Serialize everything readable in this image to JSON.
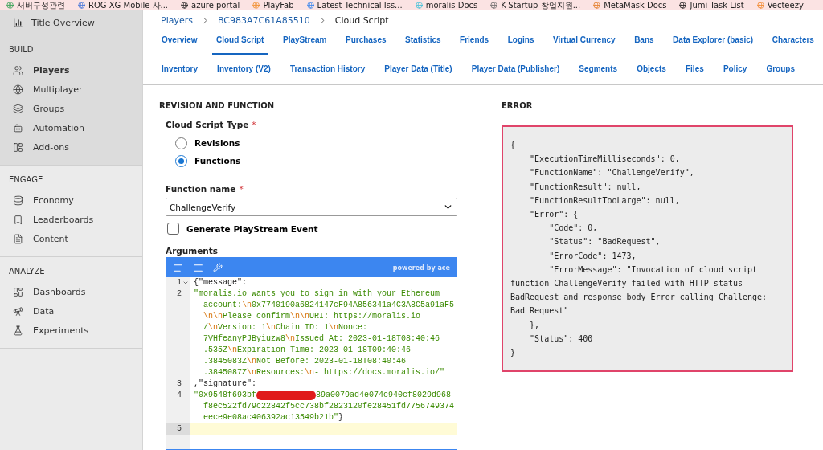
{
  "bookmarks": [
    "서버구성관련",
    "ROG XG Mobile 사...",
    "azure portal",
    "PlayFab",
    "Latest Technical Iss...",
    "moralis Docs",
    "K-Startup 창업지원...",
    "MetaMask Docs",
    "Jumi Task List",
    "Vecteezy"
  ],
  "sidebar": {
    "top": {
      "label": "Title Overview"
    },
    "sections": [
      {
        "title": "BUILD",
        "items": [
          {
            "label": "Players",
            "selected": true
          },
          {
            "label": "Multiplayer",
            "selected": false
          },
          {
            "label": "Groups",
            "selected": false
          },
          {
            "label": "Automation",
            "selected": false
          },
          {
            "label": "Add-ons",
            "selected": false
          }
        ]
      },
      {
        "title": "ENGAGE",
        "items": [
          {
            "label": "Economy",
            "selected": false
          },
          {
            "label": "Leaderboards",
            "selected": false
          },
          {
            "label": "Content",
            "selected": false
          }
        ]
      },
      {
        "title": "ANALYZE",
        "items": [
          {
            "label": "Dashboards",
            "selected": false
          },
          {
            "label": "Data",
            "selected": false
          },
          {
            "label": "Experiments",
            "selected": false
          }
        ]
      }
    ]
  },
  "breadcrumb": [
    "Players",
    "BC983A7C61A85510",
    "Cloud Script"
  ],
  "tab_rows": [
    [
      {
        "label": "Overview",
        "selected": false
      },
      {
        "label": "Cloud Script",
        "selected": true
      },
      {
        "label": "PlayStream",
        "selected": false
      },
      {
        "label": "Purchases",
        "selected": false
      },
      {
        "label": "Statistics",
        "selected": false
      },
      {
        "label": "Friends",
        "selected": false
      },
      {
        "label": "Logins",
        "selected": false
      },
      {
        "label": "Virtual Currency",
        "selected": false
      },
      {
        "label": "Bans",
        "selected": false
      },
      {
        "label": "Data Explorer (basic)",
        "selected": false
      },
      {
        "label": "Characters",
        "selected": false
      }
    ],
    [
      {
        "label": "Inventory",
        "selected": false
      },
      {
        "label": "Inventory (V2)",
        "selected": false
      },
      {
        "label": "Transaction History",
        "selected": false
      },
      {
        "label": "Player Data (Title)",
        "selected": false
      },
      {
        "label": "Player Data (Publisher)",
        "selected": false
      },
      {
        "label": "Segments",
        "selected": false
      },
      {
        "label": "Objects",
        "selected": false
      },
      {
        "label": "Files",
        "selected": false
      },
      {
        "label": "Policy",
        "selected": false
      },
      {
        "label": "Groups",
        "selected": false
      }
    ]
  ],
  "revision": {
    "heading": "REVISION AND FUNCTION",
    "type_label": "Cloud Script Type",
    "type_mark": "*",
    "types": [
      {
        "label": "Revisions",
        "selected": false
      },
      {
        "label": "Functions",
        "selected": true
      }
    ],
    "function_label": "Function name",
    "function_mark": "*",
    "function_value": "ChallengeVerify",
    "playstream": {
      "label": "Generate PlayStream Event",
      "checked": false
    },
    "arguments_label": "Arguments",
    "editor_brand": "powered by ace",
    "lines": [
      {
        "number": "1",
        "fold": true,
        "active": false,
        "rows": [
          {
            "segments": [
              {
                "kind": "text",
                "text": "{\"message\":"
              }
            ]
          }
        ]
      },
      {
        "number": "2",
        "fold": false,
        "active": false,
        "rows": [
          {
            "segments": [
              {
                "kind": "string",
                "text": "\"moralis.io wants you to sign in with your Ethereum"
              }
            ]
          },
          {
            "segments": [
              {
                "kind": "string",
                "text": "account:"
              },
              {
                "kind": "escape",
                "text": "\\n"
              },
              {
                "kind": "string",
                "text": "0x7740190a6824147cF94A856341a4C3A8C5a91aF5"
              }
            ]
          },
          {
            "segments": [
              {
                "kind": "escape",
                "text": "\\n\\n"
              },
              {
                "kind": "string",
                "text": "Please confirm"
              },
              {
                "kind": "escape",
                "text": "\\n\\n"
              },
              {
                "kind": "string",
                "text": "URI: https://moralis.io"
              }
            ]
          },
          {
            "segments": [
              {
                "kind": "string",
                "text": "/"
              },
              {
                "kind": "escape",
                "text": "\\n"
              },
              {
                "kind": "string",
                "text": "Version: 1"
              },
              {
                "kind": "escape",
                "text": "\\n"
              },
              {
                "kind": "string",
                "text": "Chain ID: 1"
              },
              {
                "kind": "escape",
                "text": "\\n"
              },
              {
                "kind": "string",
                "text": "Nonce:"
              }
            ]
          },
          {
            "segments": [
              {
                "kind": "string",
                "text": "7VHfeanyPJByiuzW8"
              },
              {
                "kind": "escape",
                "text": "\\n"
              },
              {
                "kind": "string",
                "text": "Issued At: 2023-01-18T08:40:46"
              }
            ]
          },
          {
            "segments": [
              {
                "kind": "string",
                "text": ".535Z"
              },
              {
                "kind": "escape",
                "text": "\\n"
              },
              {
                "kind": "string",
                "text": "Expiration Time: 2023-01-18T09:40:46"
              }
            ]
          },
          {
            "segments": [
              {
                "kind": "string",
                "text": ".3845083Z"
              },
              {
                "kind": "escape",
                "text": "\\n"
              },
              {
                "kind": "string",
                "text": "Not Before: 2023-01-18T08:40:46"
              }
            ]
          },
          {
            "segments": [
              {
                "kind": "string",
                "text": ".3845087Z"
              },
              {
                "kind": "escape",
                "text": "\\n"
              },
              {
                "kind": "string",
                "text": "Resources:"
              },
              {
                "kind": "escape",
                "text": "\\n"
              },
              {
                "kind": "string",
                "text": "- https://docs.moralis.io/\""
              }
            ]
          }
        ]
      },
      {
        "number": "3",
        "fold": false,
        "active": false,
        "rows": [
          {
            "segments": [
              {
                "kind": "text",
                "text": ",\"signature\":"
              }
            ]
          }
        ]
      },
      {
        "number": "4",
        "fold": false,
        "active": false,
        "rows": [
          {
            "segments": [
              {
                "kind": "string",
                "text": "\"0x9548f693bf"
              },
              {
                "kind": "redaction"
              },
              {
                "kind": "string",
                "text": "89a0079ad4e074c940cf8029d968"
              }
            ]
          },
          {
            "segments": [
              {
                "kind": "string",
                "text": "f8ec522fd79c22842f5cc738bf2823120fe28451fd7756749374"
              }
            ]
          },
          {
            "segments": [
              {
                "kind": "string",
                "text": "eece9e08ac406392ac13549b21b\""
              },
              {
                "kind": "text",
                "text": "}"
              }
            ]
          }
        ]
      },
      {
        "number": "5",
        "fold": false,
        "active": true,
        "rows": [
          {
            "segments": []
          }
        ]
      }
    ]
  },
  "error": {
    "heading": "ERROR",
    "lines": [
      "{",
      "    \"ExecutionTimeMilliseconds\": 0,",
      "    \"FunctionName\": \"ChallengeVerify\",",
      "    \"FunctionResult\": null,",
      "    \"FunctionResultTooLarge\": null,",
      "    \"Error\": {",
      "        \"Code\": 0,",
      "        \"Status\": \"BadRequest\",",
      "        \"ErrorCode\": 1473,",
      "        \"ErrorMessage\": \"Invocation of cloud script",
      "function ChallengeVerify failed with HTTP status",
      "BadRequest and response body Error calling Challenge:",
      "Bad Request\"",
      "    },",
      "    \"Status\": 400",
      "}"
    ]
  }
}
